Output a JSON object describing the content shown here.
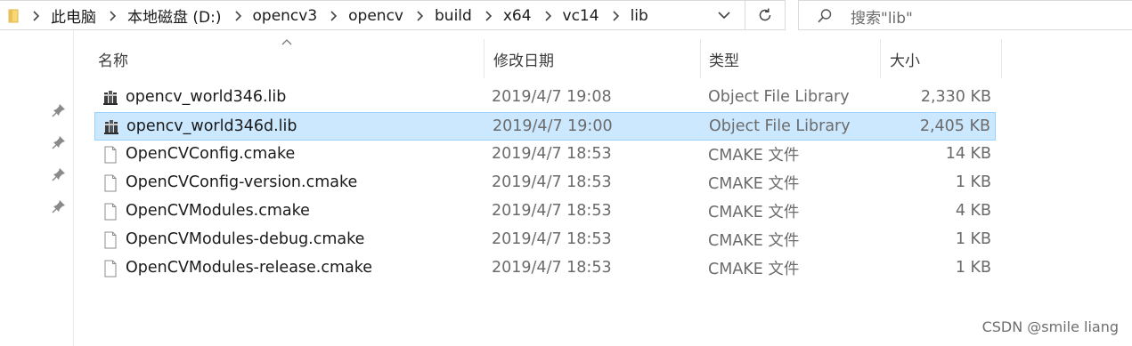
{
  "address_bar": {
    "segments": [
      "此电脑",
      "本地磁盘 (D:)",
      "opencv3",
      "opencv",
      "build",
      "x64",
      "vc14",
      "lib"
    ]
  },
  "search": {
    "placeholder": "搜索\"lib\""
  },
  "columns": {
    "name": "名称",
    "date": "修改日期",
    "type": "类型",
    "size": "大小"
  },
  "files": [
    {
      "name": "opencv_world346.lib",
      "date": "2019/4/7 19:08",
      "type": "Object File Library",
      "size": "2,330 KB",
      "icon": "library-file-icon",
      "selected": false
    },
    {
      "name": "opencv_world346d.lib",
      "date": "2019/4/7 19:00",
      "type": "Object File Library",
      "size": "2,405 KB",
      "icon": "library-file-icon",
      "selected": true
    },
    {
      "name": "OpenCVConfig.cmake",
      "date": "2019/4/7 18:53",
      "type": "CMAKE 文件",
      "size": "14 KB",
      "icon": "blank-file-icon",
      "selected": false
    },
    {
      "name": "OpenCVConfig-version.cmake",
      "date": "2019/4/7 18:53",
      "type": "CMAKE 文件",
      "size": "1 KB",
      "icon": "blank-file-icon",
      "selected": false
    },
    {
      "name": "OpenCVModules.cmake",
      "date": "2019/4/7 18:53",
      "type": "CMAKE 文件",
      "size": "4 KB",
      "icon": "blank-file-icon",
      "selected": false
    },
    {
      "name": "OpenCVModules-debug.cmake",
      "date": "2019/4/7 18:53",
      "type": "CMAKE 文件",
      "size": "1 KB",
      "icon": "blank-file-icon",
      "selected": false
    },
    {
      "name": "OpenCVModules-release.cmake",
      "date": "2019/4/7 18:53",
      "type": "CMAKE 文件",
      "size": "1 KB",
      "icon": "blank-file-icon",
      "selected": false
    }
  ],
  "watermark": "CSDN @smile liang",
  "colors": {
    "selection_bg": "#cce8ff",
    "selection_border": "#99d1ff",
    "folder_yellow": "#f8d775"
  }
}
